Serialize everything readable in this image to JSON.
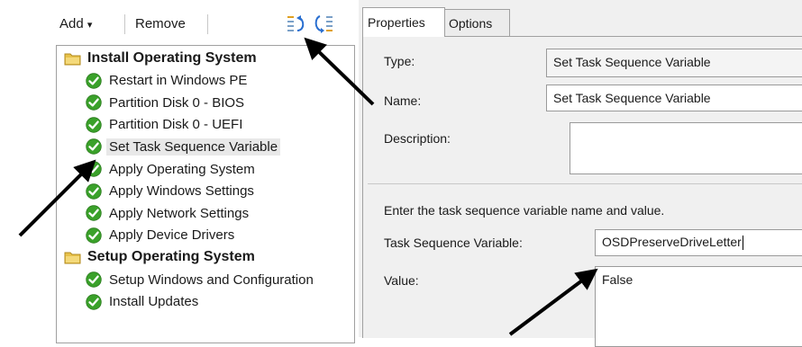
{
  "toolbar": {
    "add_label": "Add",
    "add_caret": "▾",
    "remove_label": "Remove",
    "icons": [
      "move-up-icon",
      "move-down-icon"
    ]
  },
  "tree": {
    "items": [
      {
        "label": "Install Operating System",
        "kind": "group",
        "icon": "folder-icon"
      },
      {
        "label": "Restart in Windows PE",
        "kind": "step",
        "icon": "green-check-icon"
      },
      {
        "label": "Partition Disk 0 - BIOS",
        "kind": "step",
        "icon": "green-check-icon"
      },
      {
        "label": "Partition Disk 0 - UEFI",
        "kind": "step",
        "icon": "green-check-icon"
      },
      {
        "label": "Set Task Sequence Variable",
        "kind": "step",
        "icon": "green-check-icon",
        "selected": true
      },
      {
        "label": "Apply Operating System",
        "kind": "step",
        "icon": "green-check-icon"
      },
      {
        "label": "Apply Windows Settings",
        "kind": "step",
        "icon": "green-check-icon"
      },
      {
        "label": "Apply Network Settings",
        "kind": "step",
        "icon": "green-check-icon"
      },
      {
        "label": "Apply Device Drivers",
        "kind": "step",
        "icon": "green-check-icon"
      },
      {
        "label": "Setup Operating System",
        "kind": "group",
        "icon": "folder-icon"
      },
      {
        "label": "Setup Windows and Configuration",
        "kind": "step",
        "icon": "green-check-icon"
      },
      {
        "label": "Install Updates",
        "kind": "step",
        "icon": "green-check-icon"
      }
    ]
  },
  "tabs": {
    "properties": "Properties",
    "options": "Options"
  },
  "properties": {
    "type_label": "Type:",
    "type_value": "Set Task Sequence Variable",
    "name_label": "Name:",
    "name_value": "Set Task Sequence Variable",
    "description_label": "Description:",
    "description_value": "",
    "instructions": "Enter the task sequence variable name and value.",
    "variable_label": "Task Sequence Variable:",
    "variable_value": "OSDPreserveDriveLetter",
    "value_label": "Value:",
    "value_value": "False"
  },
  "colors": {
    "check_green": "#3aa12a",
    "folder_yellow": "#e8c24a",
    "selection_gray": "#e8e8e8",
    "panel_gray": "#f0f0f0"
  }
}
